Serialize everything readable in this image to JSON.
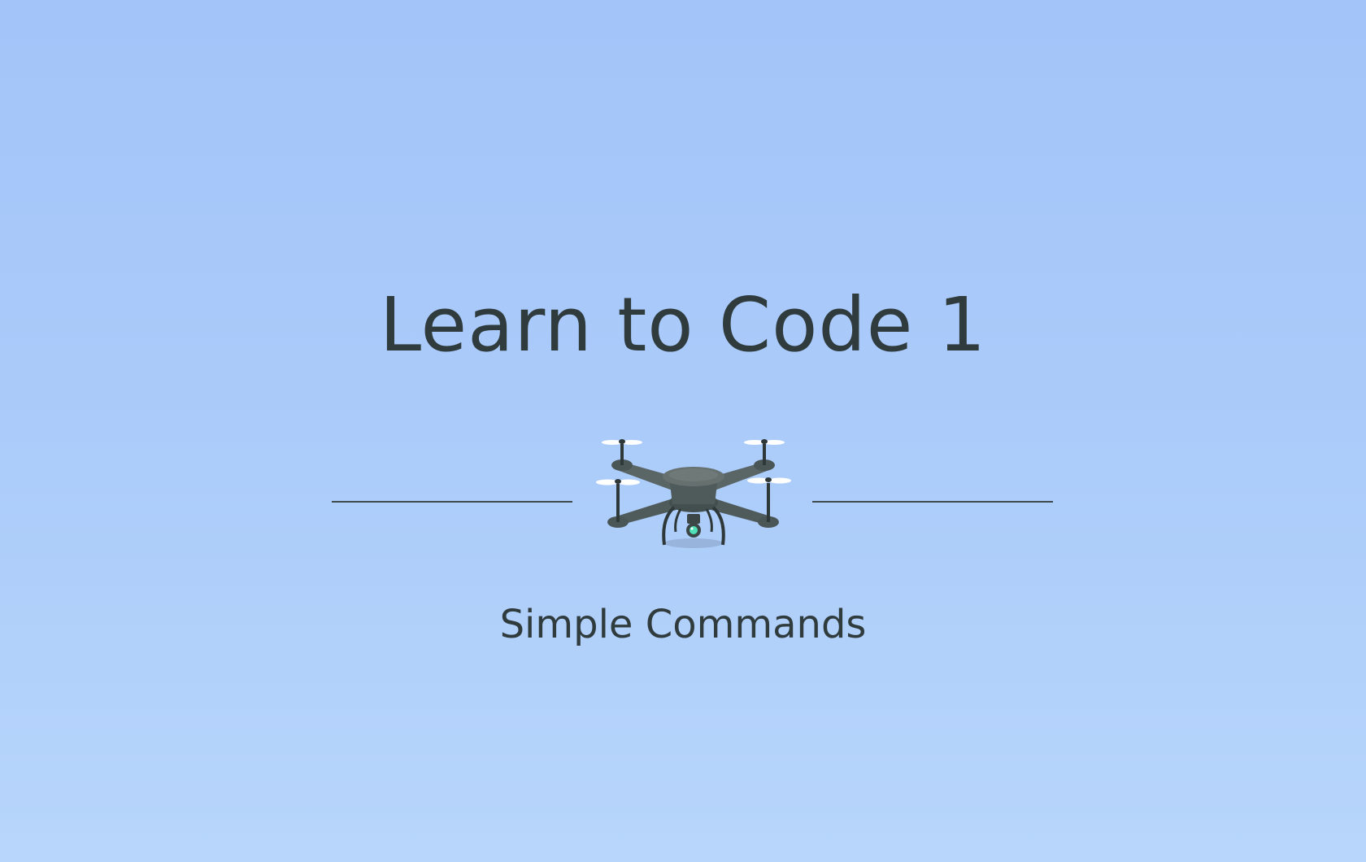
{
  "title": "Learn to Code 1",
  "subtitle": "Simple Commands",
  "illustration": {
    "icon": "drone-icon"
  },
  "colors": {
    "background_top": "#a2c4f8",
    "background_bottom": "#b8d6fb",
    "text": "#2f3b3d",
    "drone_body": "#5a6566",
    "drone_light": "#4fe0b8"
  }
}
